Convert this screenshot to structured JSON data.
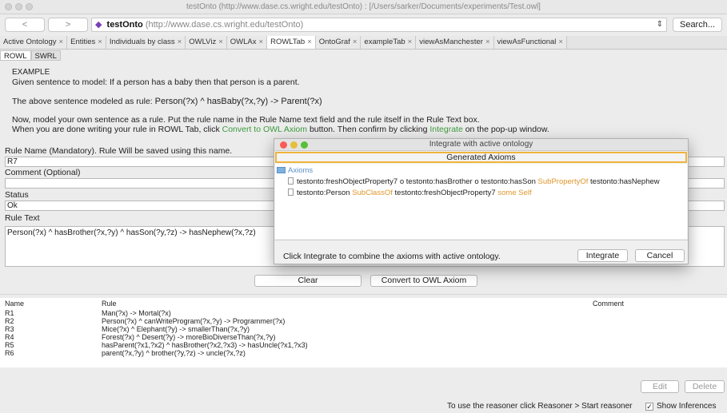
{
  "window": {
    "title": "testOnto (http://www.dase.cs.wright.edu/testOnto)  : [/Users/sarker/Documents/experiments/Test.owl]"
  },
  "address_bar": {
    "back_label": "<",
    "forward_label": ">",
    "ontology_name": "testOnto",
    "ontology_url": "(http://www.dase.cs.wright.edu/testOnto)",
    "updown_icon": "updown-arrows-icon",
    "search_label": "Search..."
  },
  "tabs": [
    {
      "label": "Active Ontology"
    },
    {
      "label": "Entities"
    },
    {
      "label": "Individuals by class"
    },
    {
      "label": "OWLViz"
    },
    {
      "label": "OWLAx"
    },
    {
      "label": "ROWLTab"
    },
    {
      "label": "OntoGraf"
    },
    {
      "label": "exampleTab"
    },
    {
      "label": "viewAsManchester"
    },
    {
      "label": "viewAsFunctional"
    }
  ],
  "active_tab": "ROWLTab",
  "subtabs": [
    {
      "label": "ROWL"
    },
    {
      "label": "SWRL"
    }
  ],
  "instructions": {
    "example_heading": "EXAMPLE",
    "given_sentence": "Given sentence to model: If a person has a baby then that person is a parent.",
    "modeled_prefix": "The above sentence modeled as rule:",
    "modeled_rule": "Person(?x) ^ hasBaby(?x,?y) -> Parent(?x)",
    "now_text": "Now, model your own sentence as a rule. Put the rule name in the Rule Name text field and the rule itself in the Rule Text box.",
    "when_prefix": "When you are done writing your rule in ROWL Tab, click",
    "convert_link": "Convert to OWL Axiom",
    "when_middle": "button. Then confirm by clicking",
    "integrate_link": "Integrate",
    "when_suffix": "on the pop-up window."
  },
  "form": {
    "rule_name_label": "Rule Name (Mandatory). Rule Will be saved using this name.",
    "rule_name_value": "R7",
    "comment_label": "Comment (Optional)",
    "comment_value": "",
    "status_label": "Status",
    "status_value": "Ok",
    "rule_text_label": "Rule Text",
    "rule_text_value": "Person(?x) ^ hasBrother(?x,?y) ^ hasSon(?y,?z) -> hasNephew(?x,?z)",
    "clear_label": "Clear",
    "convert_label": "Convert to OWL Axiom"
  },
  "rules_table": {
    "headers": {
      "name": "Name",
      "rule": "Rule",
      "comment": "Comment"
    },
    "rows": [
      {
        "name": "R1",
        "rule": "Man(?x) -> Mortal(?x)"
      },
      {
        "name": "R2",
        "rule": "Person(?x) ^ canWriteProgram(?x,?y) -> Programmer(?x)"
      },
      {
        "name": "R3",
        "rule": "Mice(?x) ^ Elephant(?y) -> smallerThan(?x,?y)"
      },
      {
        "name": "R4",
        "rule": "Forest(?x) ^ Desert(?y) -> moreBioDiverseThan(?x,?y)"
      },
      {
        "name": "R5",
        "rule": "hasParent(?x1,?x2) ^ hasBrother(?x2,?x3) -> hasUncle(?x1,?x3)"
      },
      {
        "name": "R6",
        "rule": "parent(?x,?y) ^ brother(?y,?z) -> uncle(?x,?z)"
      }
    ],
    "edit_label": "Edit",
    "delete_label": "Delete"
  },
  "footer": {
    "reasoner_hint": "To use the reasoner click Reasoner > Start reasoner",
    "show_inferences_label": "Show Inferences",
    "show_inferences_checked": "✓"
  },
  "dialog": {
    "title": "Integrate with active ontology",
    "header": "Generated Axioms",
    "axioms_label": "Axioms",
    "axiom1": {
      "part1": "testonto:freshObjectProperty7 o testonto:hasBrother o testonto:hasSon",
      "keyword": "SubPropertyOf",
      "part2": "testonto:hasNephew"
    },
    "axiom2": {
      "part1": "testonto:Person",
      "keyword1": "SubClassOf",
      "part2": "testonto:freshObjectProperty7",
      "keyword2": "some Self"
    },
    "footer_text": "Click Integrate to combine the axioms with active ontology.",
    "integrate_label": "Integrate",
    "cancel_label": "Cancel",
    "colors": {
      "close": "#fc5b57",
      "minimize": "#e5bf3c",
      "zoom": "#57c038",
      "keyword": "#e0962c",
      "highlight_border": "#f0b43c"
    }
  }
}
